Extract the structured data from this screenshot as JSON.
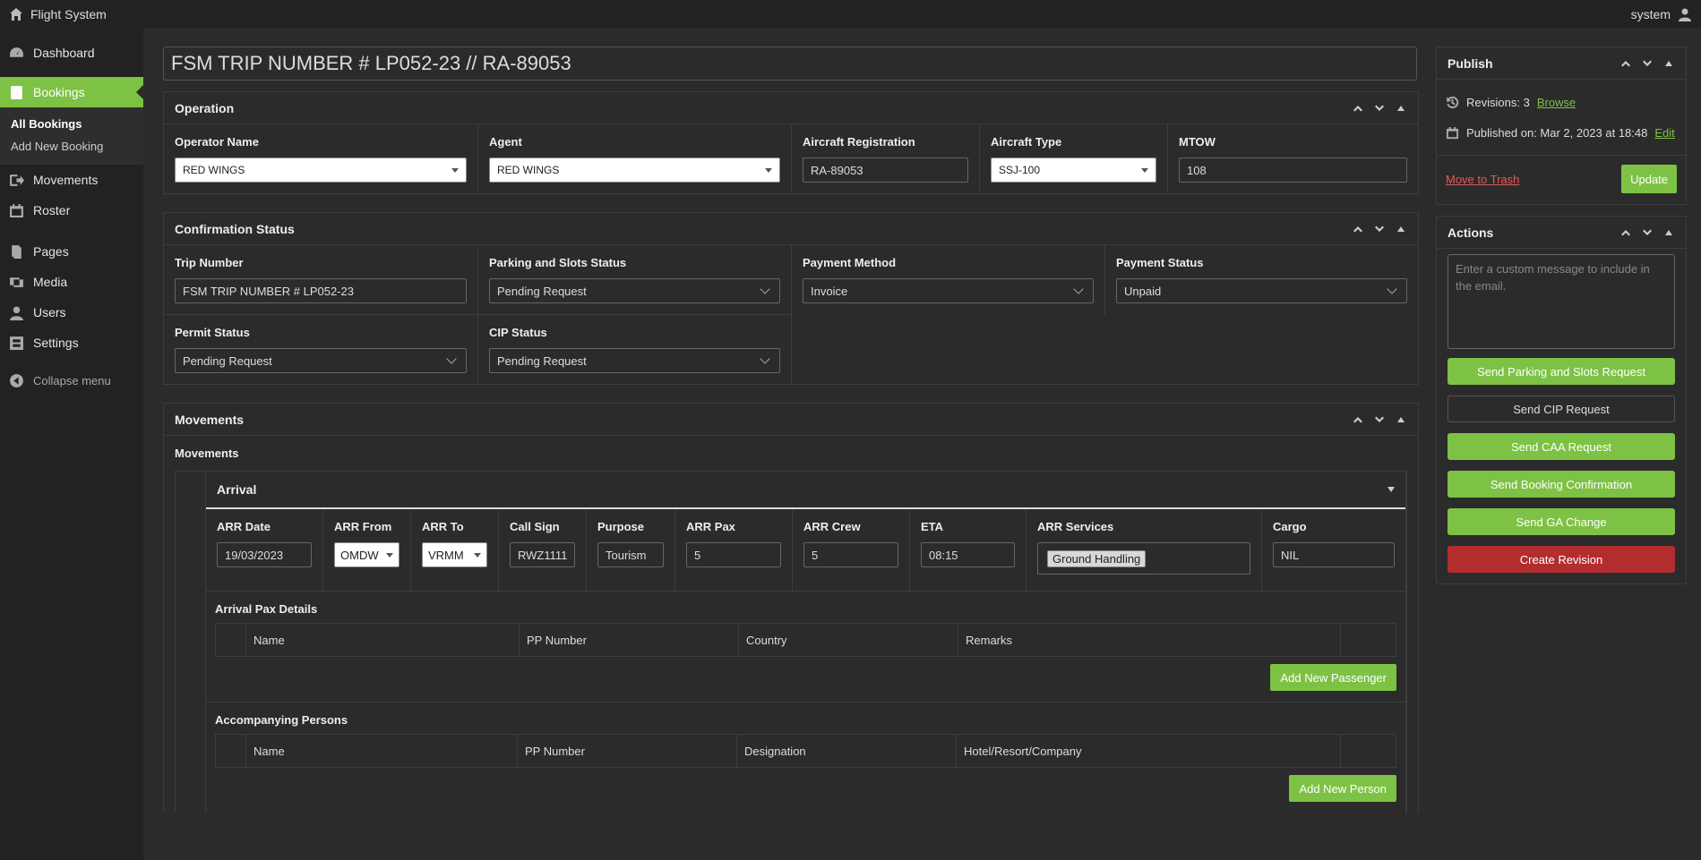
{
  "adminbar": {
    "site_name": "Flight System",
    "user": "system"
  },
  "sidebar": {
    "items": [
      {
        "label": "Dashboard",
        "icon": "dashboard-icon"
      },
      {
        "label": "Bookings",
        "icon": "bookings-icon"
      },
      {
        "label": "Movements",
        "icon": "movements-icon"
      },
      {
        "label": "Roster",
        "icon": "calendar-icon"
      },
      {
        "label": "Pages",
        "icon": "pages-icon"
      },
      {
        "label": "Media",
        "icon": "media-icon"
      },
      {
        "label": "Users",
        "icon": "users-icon"
      },
      {
        "label": "Settings",
        "icon": "settings-icon"
      }
    ],
    "submenu": [
      "All Bookings",
      "Add New Booking"
    ],
    "collapse": "Collapse menu"
  },
  "title": "FSM TRIP NUMBER # LP052-23  // RA-89053",
  "operation": {
    "heading": "Operation",
    "operator_label": "Operator Name",
    "operator_value": "RED WINGS",
    "agent_label": "Agent",
    "agent_value": "RED WINGS",
    "reg_label": "Aircraft Registration",
    "reg_value": "RA-89053",
    "type_label": "Aircraft Type",
    "type_value": "SSJ-100",
    "mtow_label": "MTOW",
    "mtow_value": "108"
  },
  "confirmation": {
    "heading": "Confirmation Status",
    "trip_label": "Trip Number",
    "trip_value": "FSM TRIP NUMBER # LP052-23",
    "parking_label": "Parking and Slots Status",
    "parking_value": "Pending Request",
    "payment_method_label": "Payment Method",
    "payment_method_value": "Invoice",
    "payment_status_label": "Payment Status",
    "payment_status_value": "Unpaid",
    "permit_label": "Permit Status",
    "permit_value": "Pending Request",
    "cip_label": "CIP Status",
    "cip_value": "Pending Request"
  },
  "movements": {
    "heading": "Movements",
    "subheading": "Movements",
    "arrival": {
      "heading": "Arrival",
      "date_label": "ARR Date",
      "date_value": "19/03/2023",
      "from_label": "ARR From",
      "from_value": "OMDW",
      "to_label": "ARR To",
      "to_value": "VRMM",
      "callsign_label": "Call Sign",
      "callsign_value": "RWZ1111",
      "purpose_label": "Purpose",
      "purpose_value": "Tourism",
      "pax_label": "ARR Pax",
      "pax_value": "5",
      "crew_label": "ARR Crew",
      "crew_value": "5",
      "eta_label": "ETA",
      "eta_value": "08:15",
      "services_label": "ARR Services",
      "services_value": "Ground Handling",
      "cargo_label": "Cargo",
      "cargo_value": "NIL"
    },
    "pax_details": {
      "title": "Arrival Pax Details",
      "columns": [
        "Name",
        "PP Number",
        "Country",
        "Remarks"
      ],
      "add_button": "Add New Passenger"
    },
    "accompanying": {
      "title": "Accompanying Persons",
      "columns": [
        "Name",
        "PP Number",
        "Designation",
        "Hotel/Resort/Company"
      ],
      "add_button": "Add New Person"
    }
  },
  "publish": {
    "heading": "Publish",
    "revisions_text": "Revisions: 3",
    "browse": "Browse",
    "published_text": "Published on: Mar 2, 2023 at 18:48",
    "edit": "Edit",
    "trash": "Move to Trash",
    "update": "Update"
  },
  "actions": {
    "heading": "Actions",
    "placeholder": "Enter a custom message to include in the email.",
    "buttons": [
      "Send Parking and Slots Request",
      "Send CIP Request",
      "Send CAA Request",
      "Send Booking Confirmation",
      "Send GA Change",
      "Create Revision"
    ]
  }
}
